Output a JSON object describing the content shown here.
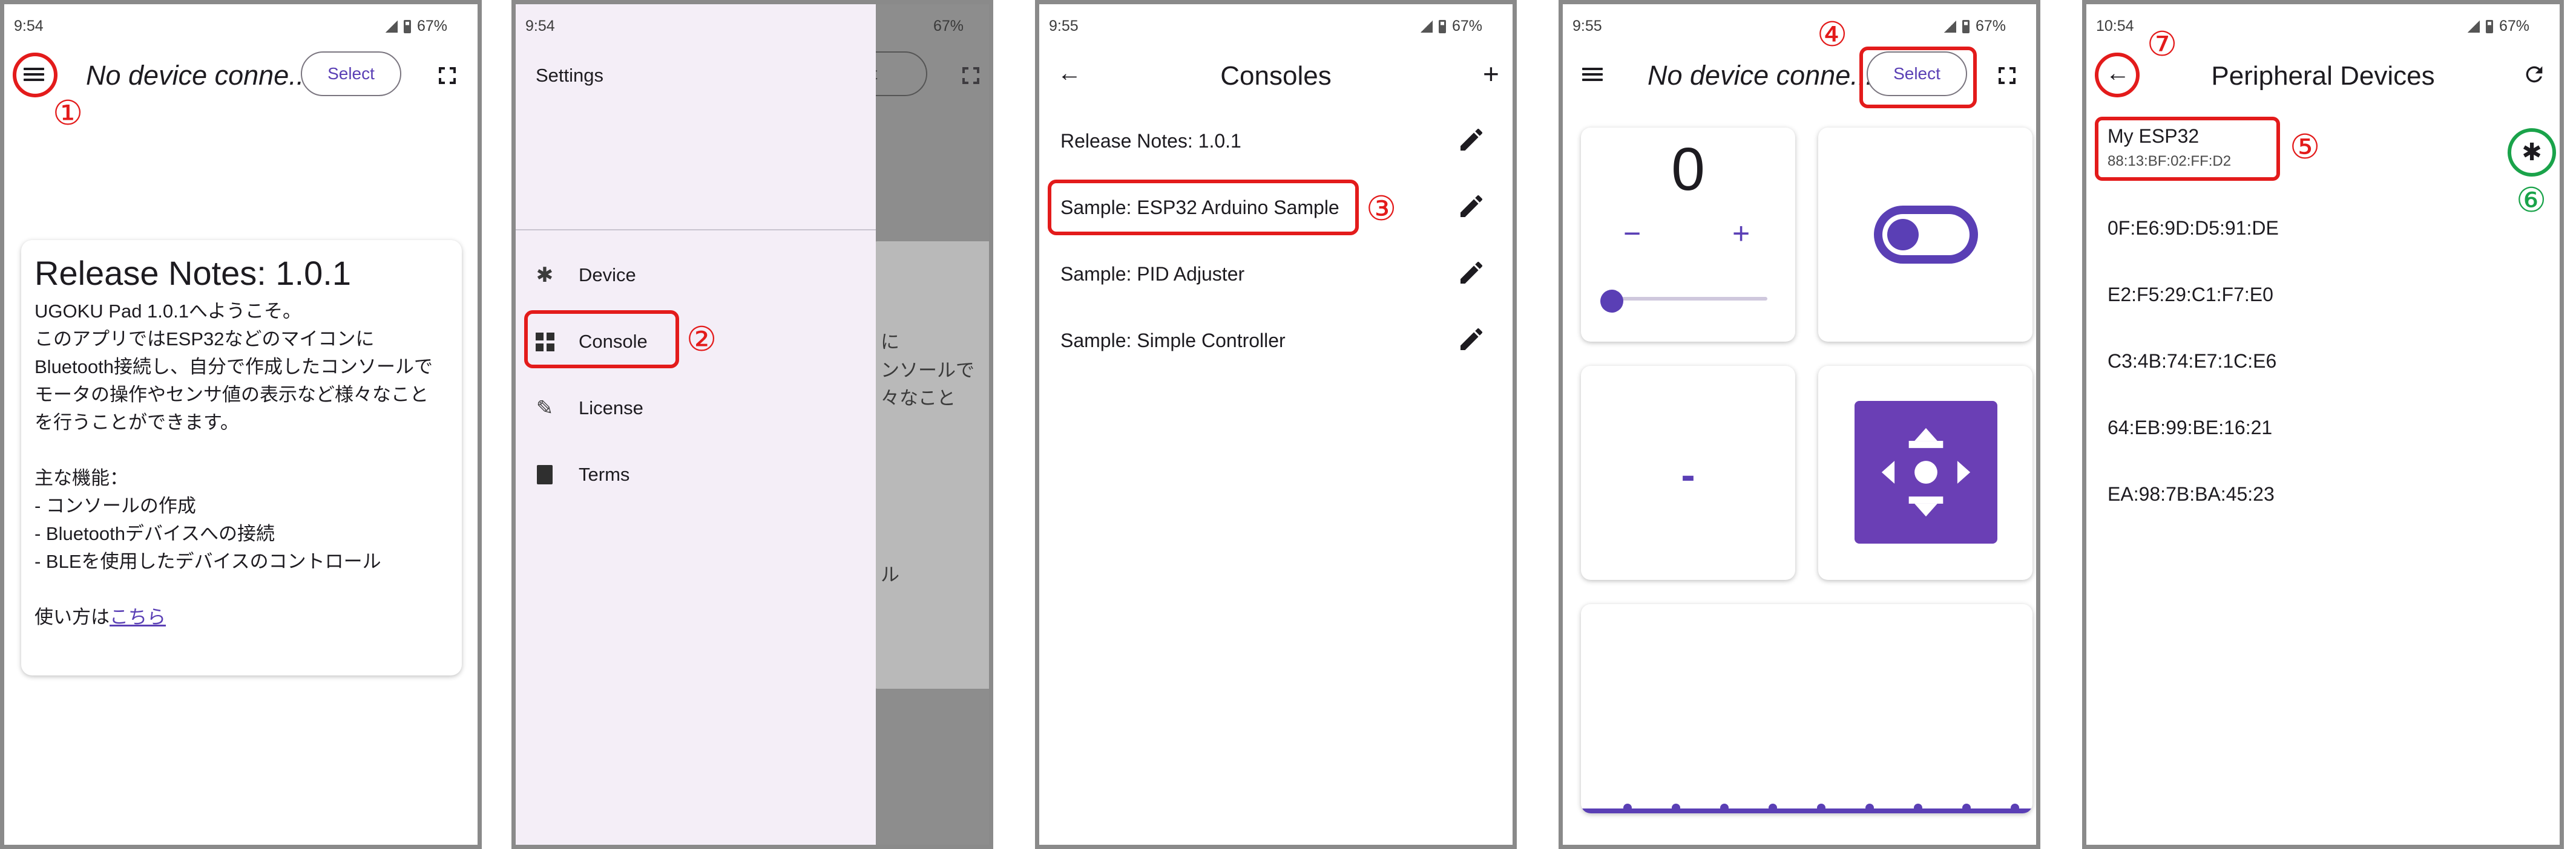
{
  "status": {
    "time_a": "9:54",
    "time_b": "9:55",
    "time_c": "10:54",
    "battery": "67%"
  },
  "p1": {
    "title": "No device conne...",
    "select_label": "Select",
    "release_notes": {
      "title": "Release Notes: 1.0.1",
      "lines": [
        "UGOKU Pad 1.0.1へようこそ。",
        "このアプリではESP32などのマイコンに",
        "Bluetooth接続し、自分で作成したコンソールで",
        "モータの操作やセンサ値の表示など様々なこと",
        "を行うことができます。",
        "",
        "主な機能：",
        "- コンソールの作成",
        "- Bluetoothデバイスへの接続",
        "- BLEを使用したデバイスのコントロール",
        ""
      ],
      "howto_prefix": "使い方は",
      "howto_link": "こちら"
    },
    "anno": "①"
  },
  "p2": {
    "settings": "Settings",
    "items": [
      "Device",
      "Console",
      "License",
      "Terms"
    ],
    "ghost_select": "ect",
    "ghost_lines": [
      "に",
      "ンソールで",
      "々なこと",
      "ル"
    ],
    "anno": "②"
  },
  "p3": {
    "title": "Consoles",
    "items": [
      "Release Notes: 1.0.1",
      "Sample: ESP32 Arduino Sample",
      "Sample: PID Adjuster",
      "Sample: Simple Controller"
    ],
    "anno": "③"
  },
  "p4": {
    "title": "No device conne...",
    "select_label": "Select",
    "counter_value": "0",
    "minus": "−",
    "plus": "+",
    "slider_level": 0,
    "toggle_on": true,
    "dash": "-",
    "anno": "④"
  },
  "p5": {
    "title": "Peripheral Devices",
    "devices": [
      {
        "name": "My ESP32",
        "addr": "88:13:BF:02:FF:D2"
      },
      {
        "name": "0F:E6:9D:D5:91:DE"
      },
      {
        "name": "E2:F5:29:C1:F7:E0"
      },
      {
        "name": "C3:4B:74:E7:1C:E6"
      },
      {
        "name": "64:EB:99:BE:16:21"
      },
      {
        "name": "EA:98:7B:BA:45:23"
      }
    ],
    "anno5": "⑤",
    "anno6": "⑥",
    "anno7": "⑦"
  },
  "colors": {
    "accent": "#5a3fb5",
    "annotation_red": "#e31b1b",
    "annotation_green": "#1aa34a"
  },
  "icons": [
    "menu-icon",
    "fullscreen-icon",
    "bluetooth-icon",
    "console-icon",
    "license-icon",
    "terms-icon",
    "back-arrow-icon",
    "plus-icon",
    "pencil-icon",
    "refresh-icon",
    "dpad-icon"
  ]
}
